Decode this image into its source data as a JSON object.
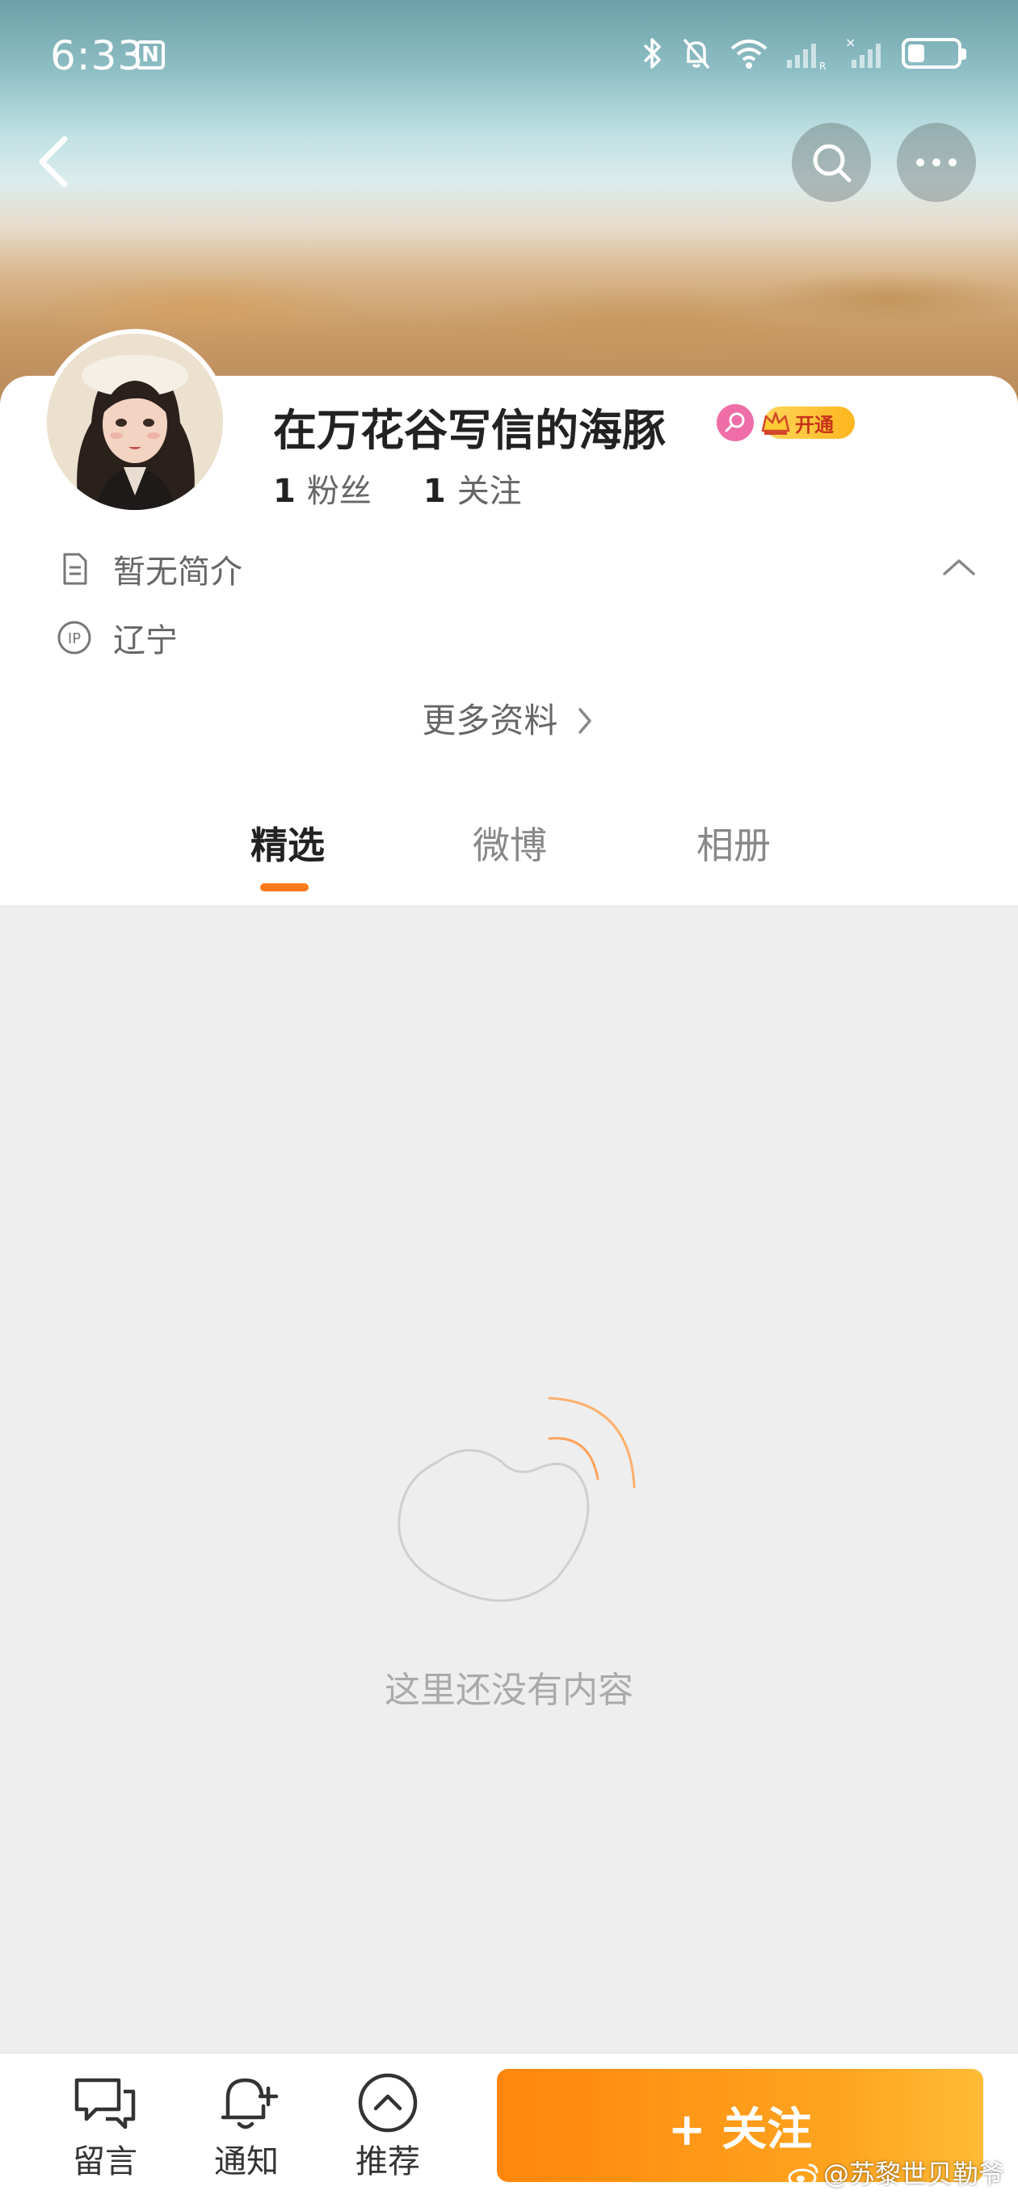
{
  "status_bar": {
    "time": "6:33",
    "nfc": "N",
    "battery_level": 0.35
  },
  "profile": {
    "username": "在万花谷写信的海豚",
    "vip_label": "开通",
    "fans_count": "1",
    "fans_label": "粉丝",
    "following_count": "1",
    "following_label": "关注",
    "bio": "暂无简介",
    "ip_badge": "IP",
    "ip_location": "辽宁",
    "more_info": "更多资料"
  },
  "tabs": [
    {
      "label": "精选"
    },
    {
      "label": "微博"
    },
    {
      "label": "相册"
    }
  ],
  "empty_state": {
    "text": "这里还没有内容"
  },
  "bottom_bar": {
    "message_label": "留言",
    "notify_label": "通知",
    "recommend_label": "推荐",
    "follow_label": "+ 关注"
  },
  "watermark": "@苏黎世贝勒爷",
  "colors": {
    "accent": "#ff7a1a",
    "follow_start": "#ff860d",
    "follow_end": "#ffbb37"
  }
}
